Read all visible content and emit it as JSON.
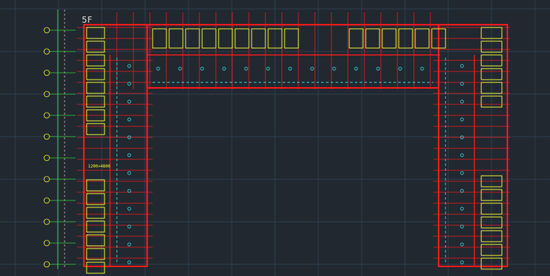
{
  "viewport": {
    "background": "#212830",
    "floor_label": "5F"
  },
  "colors": {
    "grid": "#334a5c",
    "wall": "#ff1a1a",
    "partition": "#ffff33",
    "fixture": "#33e6e6",
    "text": "#e6e6e6",
    "axis": "#3ad43a"
  },
  "axis_markers": [
    "①",
    "②",
    "③",
    "④",
    "⑤",
    "⑥",
    "⑦",
    "⑧",
    "⑨",
    "⑩",
    "⑪",
    "⑫"
  ],
  "room_labels": [
    "1200×4800"
  ]
}
